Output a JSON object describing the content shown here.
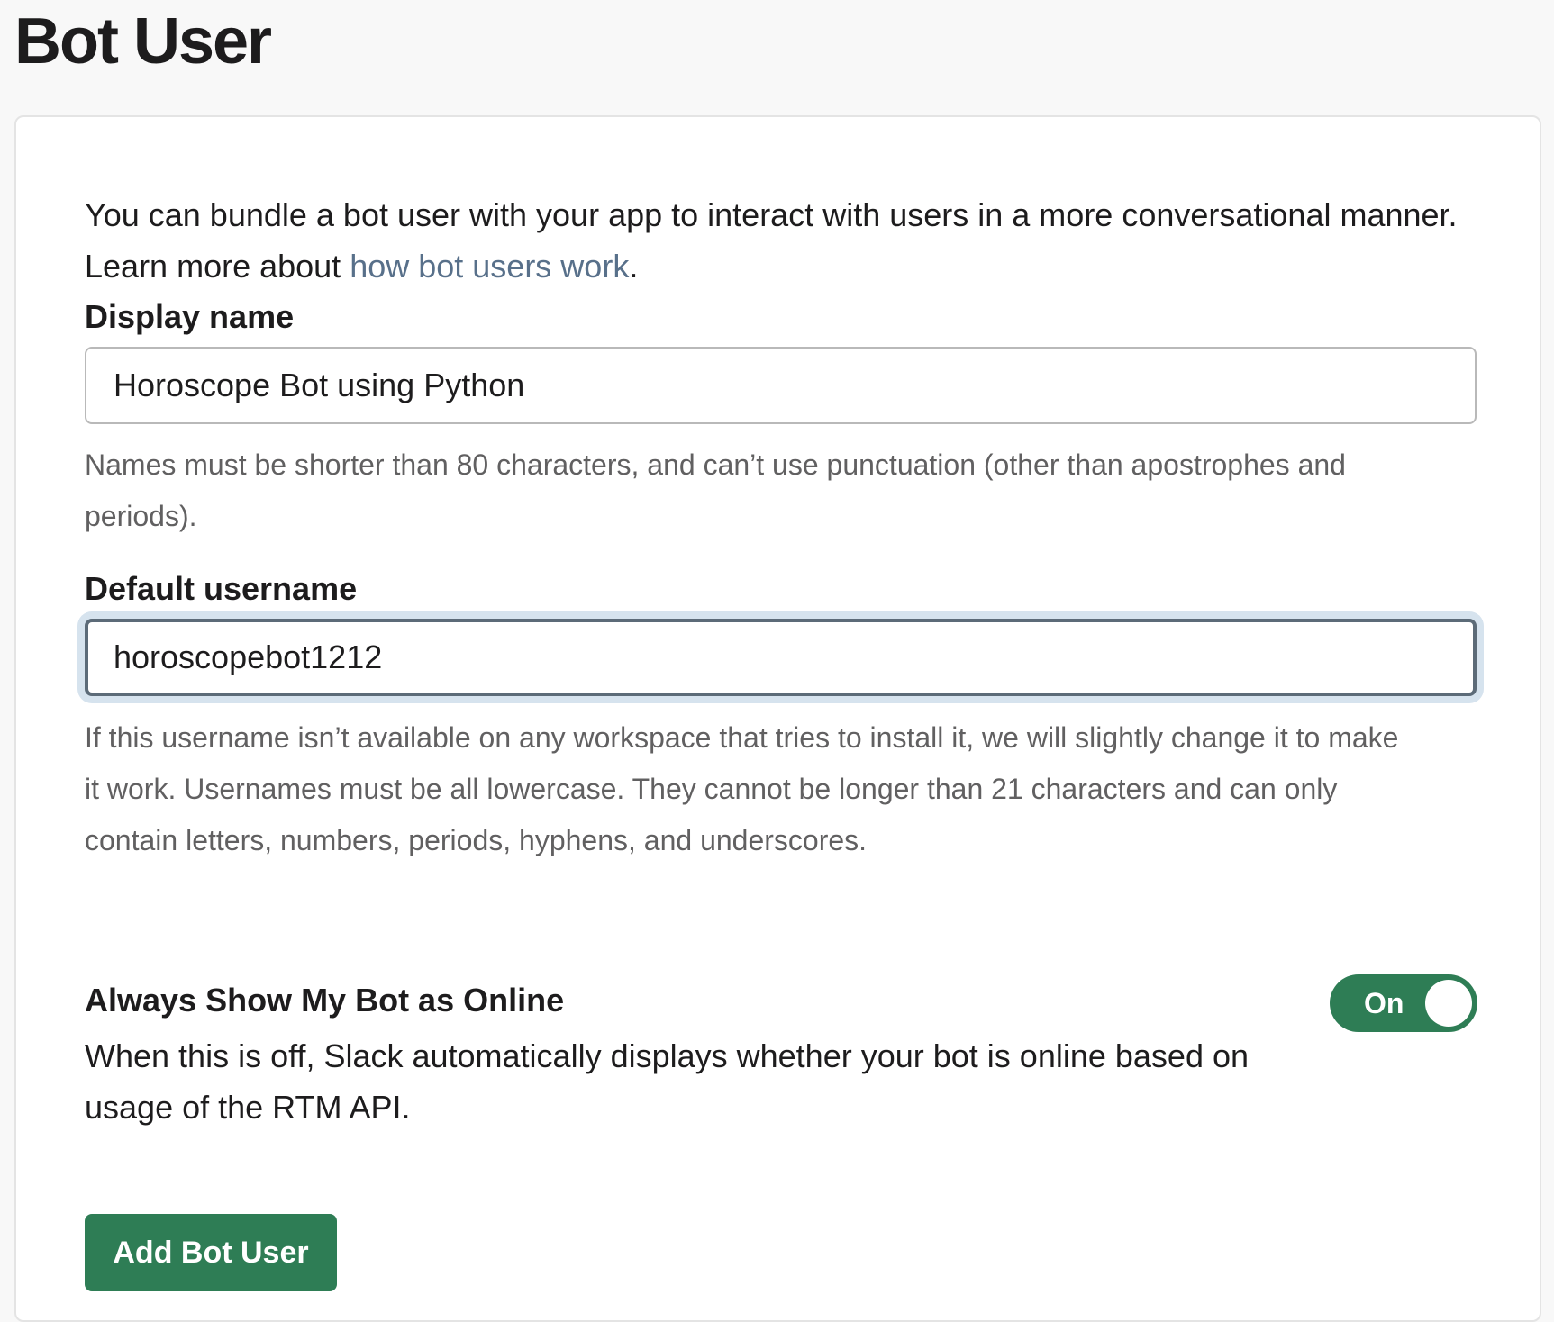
{
  "page": {
    "title": "Bot User"
  },
  "intro": {
    "text_before_link": "You can bundle a bot user with your app to interact with users in a more conversational manner. Learn more about ",
    "link_text": "how bot users work",
    "text_after_link": "."
  },
  "display_name": {
    "label": "Display name",
    "value": "Horoscope Bot using Python",
    "hint": "Names must be shorter than 80 characters, and can’t use punctuation (other than apostrophes and periods)."
  },
  "default_username": {
    "label": "Default username",
    "value": "horoscopebot1212",
    "hint": "If this username isn’t available on any workspace that tries to install it, we will slightly change it to make it work. Usernames must be all lowercase. They cannot be longer than 21 characters and can only contain letters, numbers, periods, hyphens, and underscores."
  },
  "always_online": {
    "title": "Always Show My Bot as Online",
    "description": "When this is off, Slack automatically displays whether your bot is online based on usage of the RTM API.",
    "toggle_label": "On",
    "toggle_state": true
  },
  "actions": {
    "add_bot_user_label": "Add Bot User"
  },
  "colors": {
    "accent_green": "#2e7d55",
    "link_blue": "#58708a",
    "hint_gray": "#616061",
    "focus_ring": "#d6e3ee"
  }
}
